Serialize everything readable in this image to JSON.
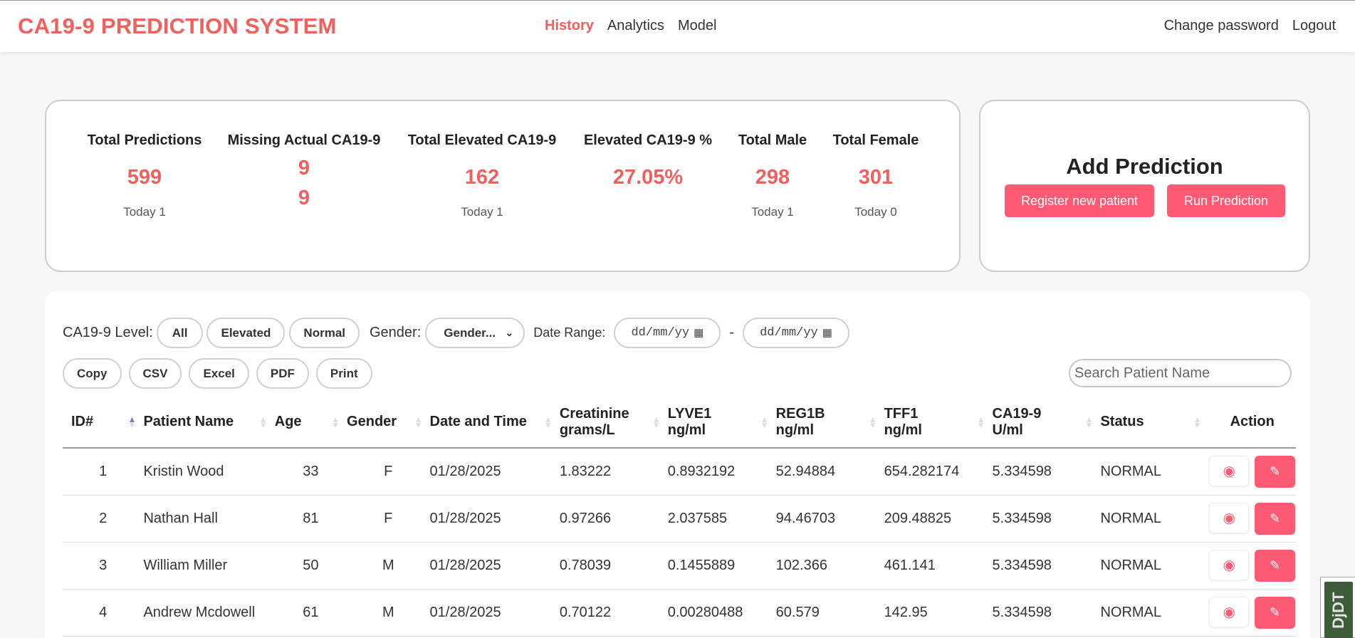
{
  "brand": "CA19-9 PREDICTION SYSTEM",
  "nav": {
    "history": "History",
    "analytics": "Analytics",
    "model": "Model"
  },
  "navright": {
    "change_password": "Change password",
    "logout": "Logout"
  },
  "stats": {
    "total_predictions": {
      "label": "Total Predictions",
      "value": "599",
      "today": "Today 1"
    },
    "missing_actual": {
      "label": "Missing Actual CA19-9",
      "value": "9",
      "value2": "9"
    },
    "total_elevated": {
      "label": "Total Elevated CA19-9",
      "value": "162",
      "today": "Today 1"
    },
    "elevated_pct": {
      "label": "Elevated CA19-9 %",
      "value": "27.05%"
    },
    "total_male": {
      "label": "Total Male",
      "value": "298",
      "today": "Today 1"
    },
    "total_female": {
      "label": "Total Female",
      "value": "301",
      "today": "Today 0"
    }
  },
  "add_prediction": {
    "title": "Add Prediction",
    "register": "Register new patient",
    "run": "Run Prediction"
  },
  "filters": {
    "level_label": "CA19-9 Level:",
    "all": "All",
    "elevated": "Elevated",
    "normal": "Normal",
    "gender_label": "Gender:",
    "gender_value": "Gender...",
    "date_label": "Date Range:",
    "date_placeholder": "dd/mm/yy",
    "date_sep": "-"
  },
  "exports": {
    "copy": "Copy",
    "csv": "CSV",
    "excel": "Excel",
    "pdf": "PDF",
    "print": "Print"
  },
  "search": {
    "placeholder": "Search Patient Name"
  },
  "table": {
    "headers": {
      "id": "ID#",
      "name": "Patient Name",
      "age": "Age",
      "gender": "Gender",
      "datetime": "Date and Time",
      "creatinine_1": "Creatinine",
      "creatinine_2": "grams/L",
      "lyve1_1": "LYVE1",
      "lyve1_2": "ng/ml",
      "reg1b_1": "REG1B",
      "reg1b_2": "ng/ml",
      "tff1_1": "TFF1",
      "tff1_2": "ng/ml",
      "ca199_1": "CA19-9",
      "ca199_2": "U/ml",
      "status": "Status",
      "action": "Action"
    },
    "rows": [
      {
        "id": "1",
        "name": "Kristin Wood",
        "age": "33",
        "gender": "F",
        "date": "01/28/2025",
        "creatinine": "1.83222",
        "lyve1": "0.8932192",
        "reg1b": "52.94884",
        "tff1": "654.282174",
        "ca199": "5.334598",
        "status": "NORMAL"
      },
      {
        "id": "2",
        "name": "Nathan Hall",
        "age": "81",
        "gender": "F",
        "date": "01/28/2025",
        "creatinine": "0.97266",
        "lyve1": "2.037585",
        "reg1b": "94.46703",
        "tff1": "209.48825",
        "ca199": "5.334598",
        "status": "NORMAL"
      },
      {
        "id": "3",
        "name": "William Miller",
        "age": "50",
        "gender": "M",
        "date": "01/28/2025",
        "creatinine": "0.78039",
        "lyve1": "0.1455889",
        "reg1b": "102.366",
        "tff1": "461.141",
        "ca199": "5.334598",
        "status": "NORMAL"
      },
      {
        "id": "4",
        "name": "Andrew Mcdowell",
        "age": "61",
        "gender": "M",
        "date": "01/28/2025",
        "creatinine": "0.70122",
        "lyve1": "0.00280488",
        "reg1b": "60.579",
        "tff1": "142.95",
        "ca199": "5.334598",
        "status": "NORMAL"
      }
    ]
  },
  "djdt": "DjDT"
}
